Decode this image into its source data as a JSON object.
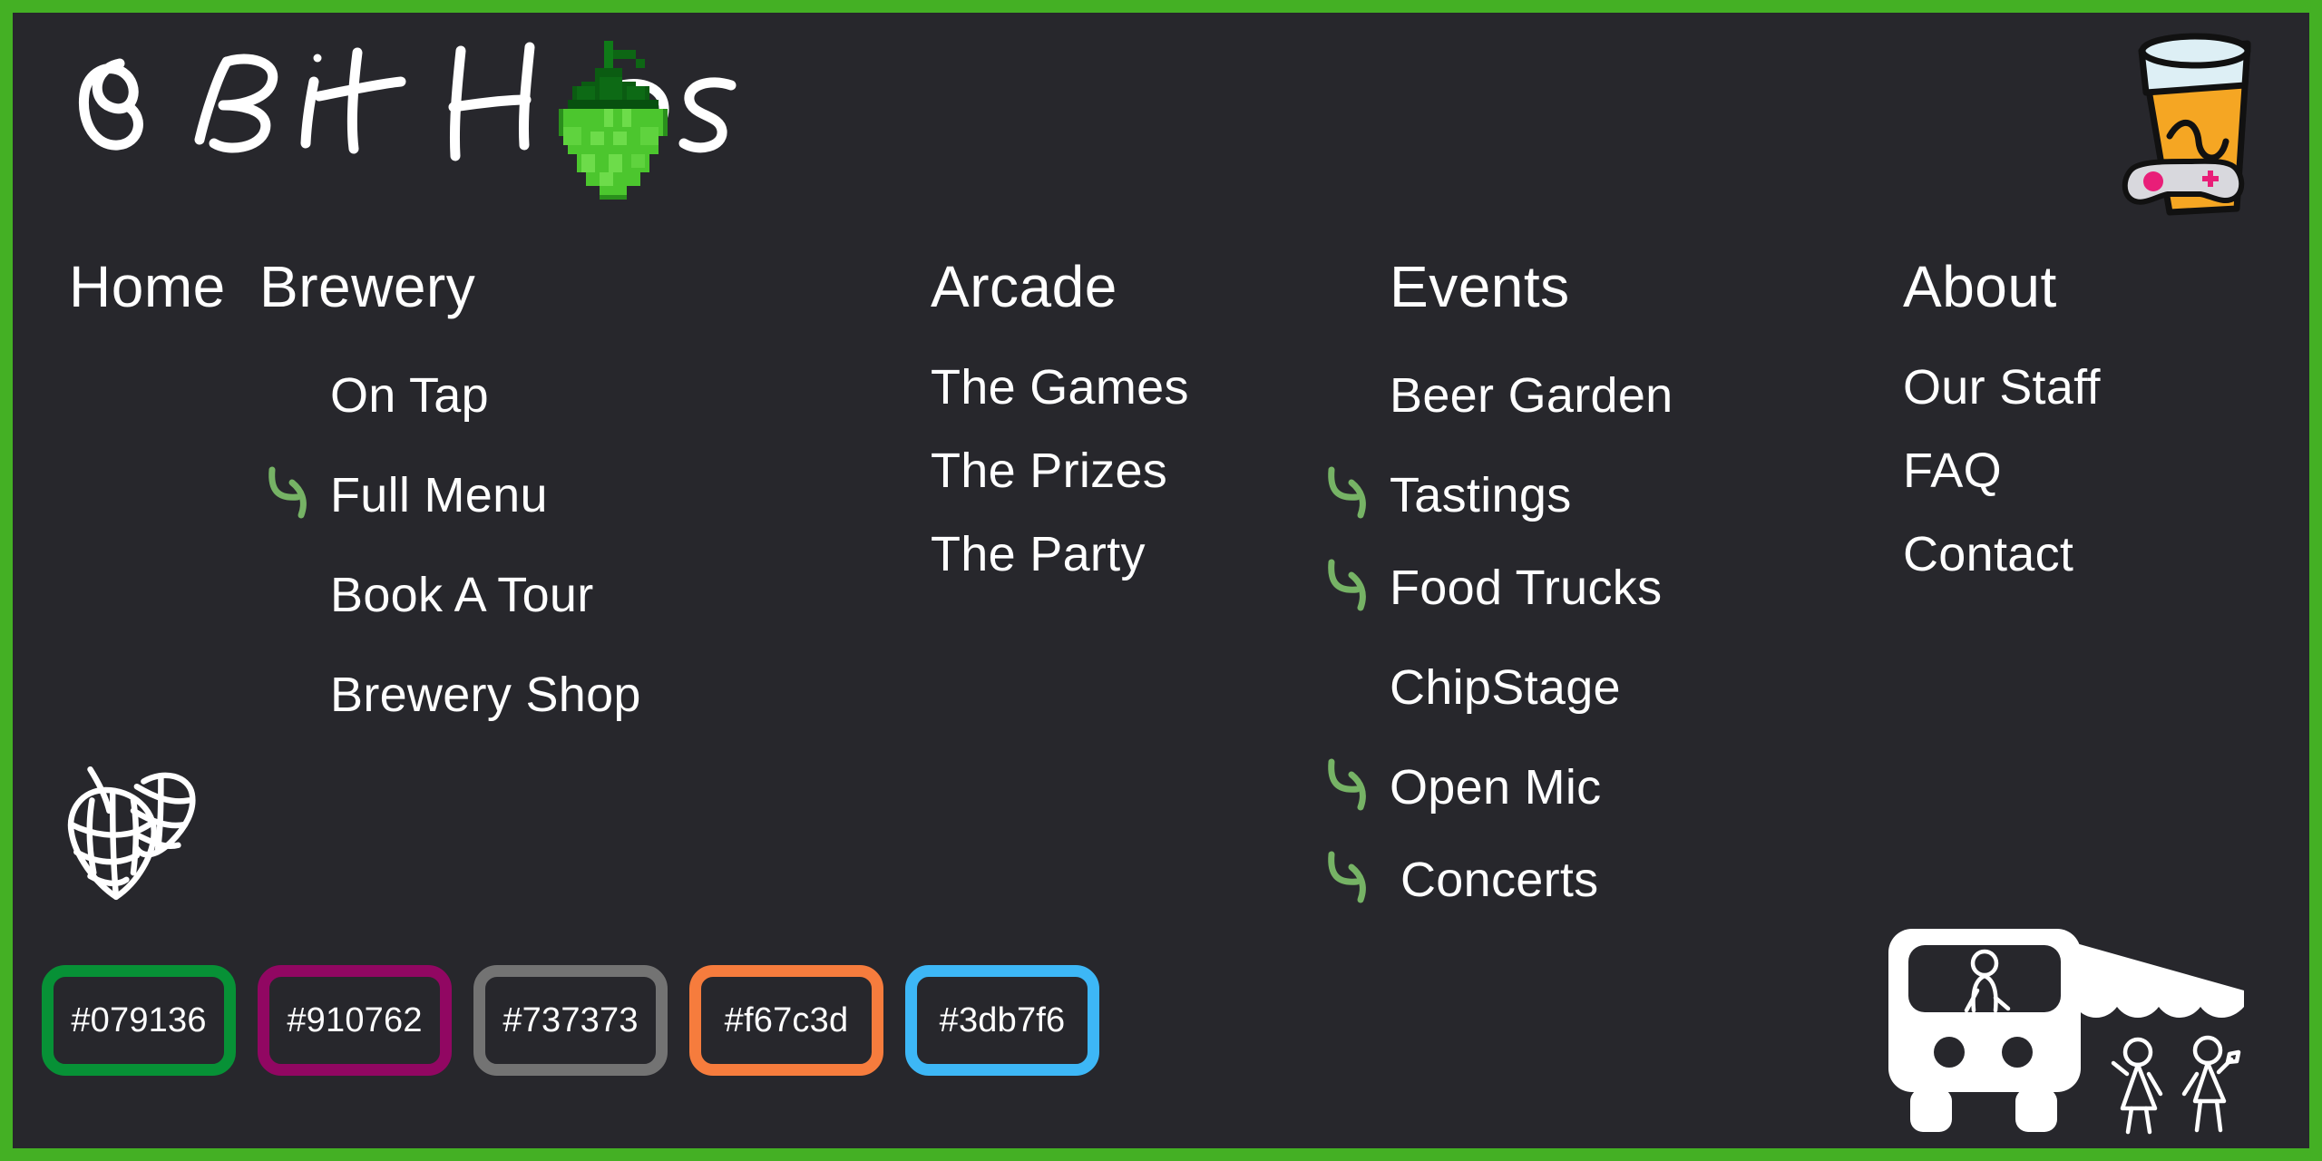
{
  "brand": {
    "name": "8 Bit Hops",
    "logo_text_parts": [
      "8",
      "Bit",
      "H",
      "ps"
    ],
    "hop_icon": "pixel-hop-cone-icon",
    "border_color": "#44b024",
    "background_color": "#27272c",
    "arrow_color": "#76b365",
    "text_color": "#ffffff"
  },
  "decor": {
    "beer_glass": {
      "name": "beer-glass-with-gamepad-icon",
      "beer_color": "#f5a623",
      "foam_color": "#ddeff5",
      "gamepad_body_color": "#d8d8dd",
      "gamepad_button_color": "#e91e78"
    },
    "hop_outline": {
      "name": "hop-cone-outline-icon",
      "color": "#ffffff"
    },
    "food_truck": {
      "name": "food-truck-icon",
      "color": "#ffffff"
    }
  },
  "nav": {
    "columns": [
      {
        "title": "Home",
        "items": []
      },
      {
        "title": "Brewery",
        "items": [
          {
            "label": "On Tap",
            "arrow": false
          },
          {
            "label": "Full Menu",
            "arrow": true
          },
          {
            "label": "Book A Tour",
            "arrow": false
          },
          {
            "label": "Brewery Shop",
            "arrow": false
          }
        ]
      },
      {
        "title": "Arcade",
        "items": [
          {
            "label": "The Games",
            "arrow": false
          },
          {
            "label": "The Prizes",
            "arrow": false
          },
          {
            "label": "The Party",
            "arrow": false
          }
        ]
      },
      {
        "title": "Events",
        "items": [
          {
            "label": "Beer Garden",
            "arrow": false
          },
          {
            "label": "Tastings",
            "arrow": true
          },
          {
            "label": "Food Trucks",
            "arrow": true
          },
          {
            "label": "ChipStage",
            "arrow": false
          },
          {
            "label": "Open Mic",
            "arrow": true
          },
          {
            "label": "Concerts",
            "arrow": true
          }
        ]
      },
      {
        "title": "About",
        "items": [
          {
            "label": "Our Staff",
            "arrow": false
          },
          {
            "label": "FAQ",
            "arrow": false
          },
          {
            "label": "Contact",
            "arrow": false
          }
        ]
      }
    ]
  },
  "palette": {
    "swatches": [
      {
        "hex": "#079136",
        "label": "#079136"
      },
      {
        "hex": "#910762",
        "label": "#910762"
      },
      {
        "hex": "#737373",
        "label": "#737373"
      },
      {
        "hex": "#f67c3d",
        "label": "#f67c3d"
      },
      {
        "hex": "#3db7f6",
        "label": "#3db7f6"
      }
    ]
  }
}
